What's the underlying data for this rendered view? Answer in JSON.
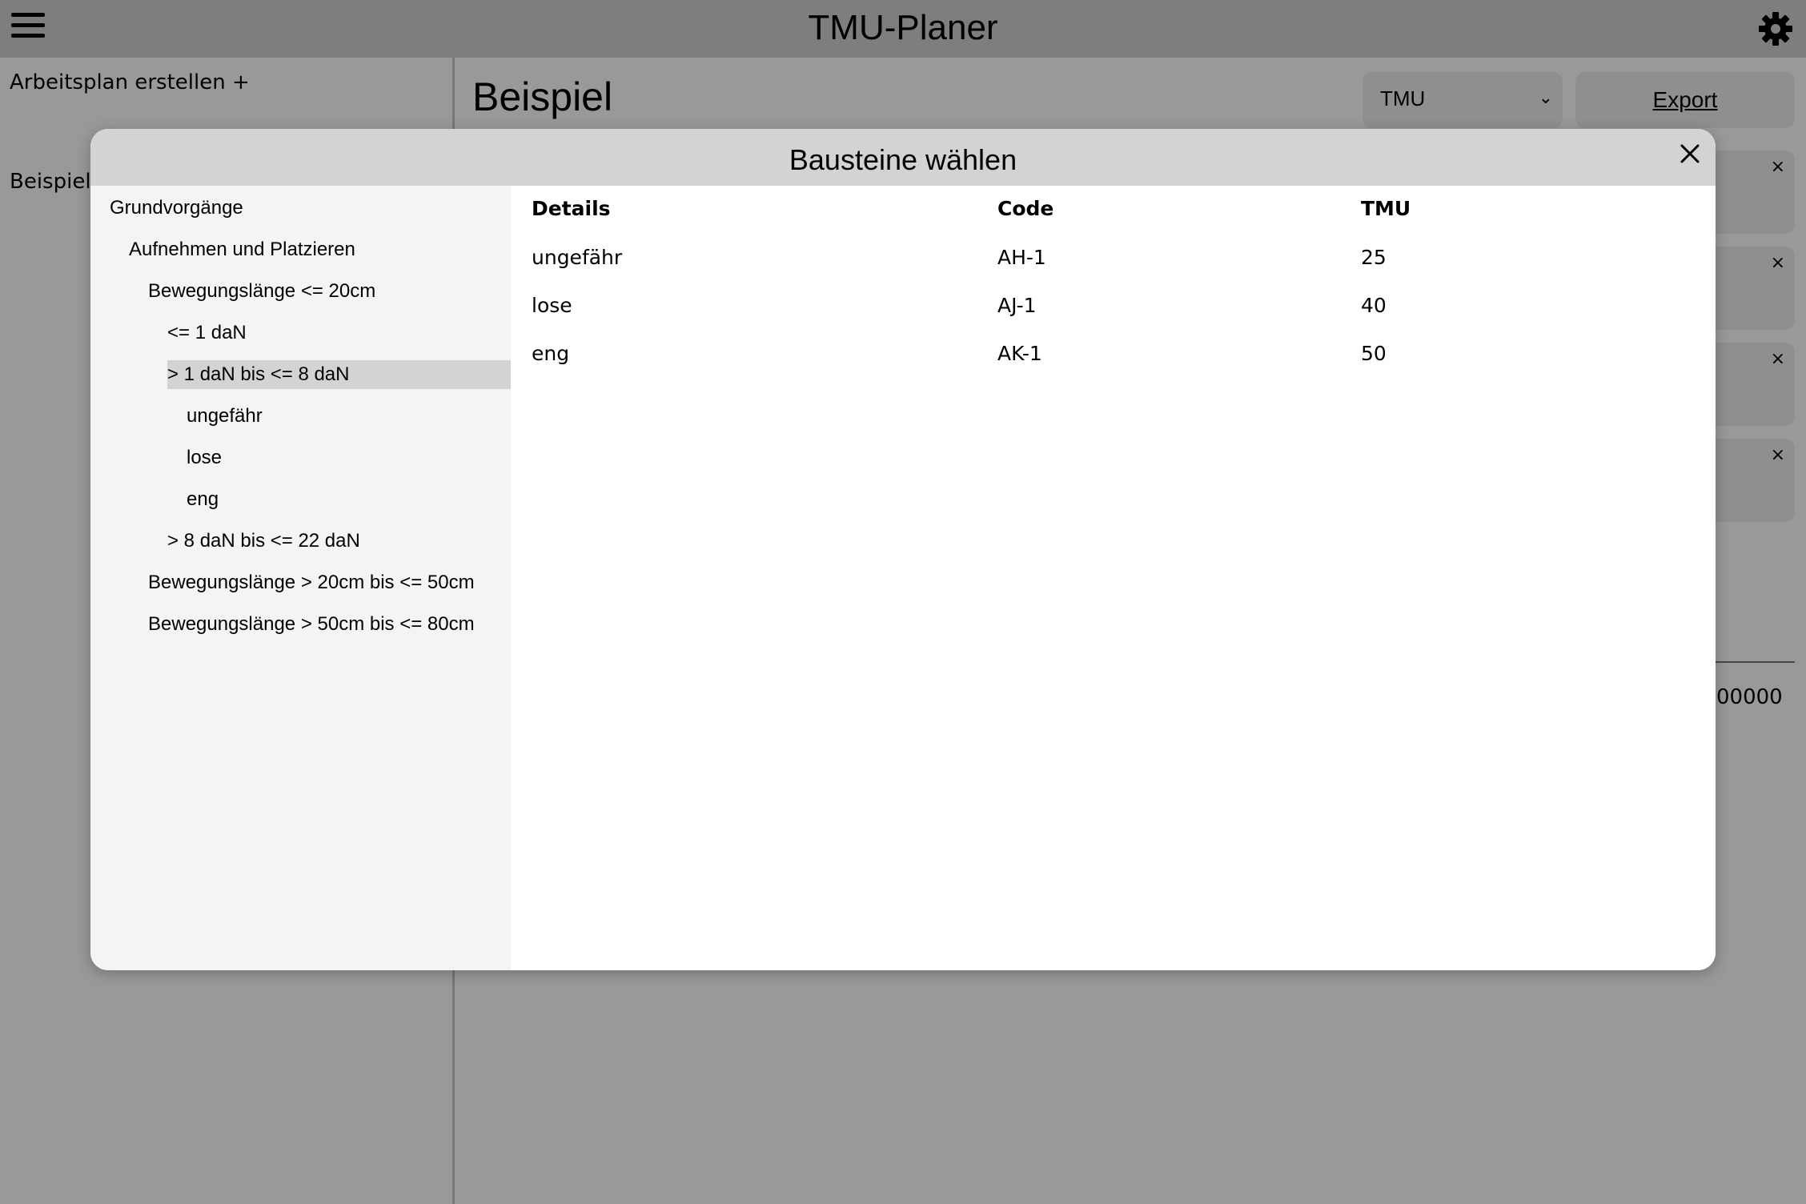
{
  "app": {
    "title": "TMU-Planer"
  },
  "topbar": {
    "menu_icon": "hamburger-menu-icon",
    "settings_icon": "gear-icon"
  },
  "sidebar": {
    "create_label": "Arbeitsplan erstellen +",
    "plans": [
      "Beispiel"
    ]
  },
  "main": {
    "title": "Beispiel",
    "unit_select": {
      "value": "TMU",
      "icon": "chevron-down-icon"
    },
    "export_label": "Export",
    "step_close_glyph": "×",
    "total_value_partial": "00000"
  },
  "modal": {
    "title": "Bausteine wählen",
    "close_icon": "close-icon",
    "tree": [
      {
        "label": "Grundvorgänge",
        "level": 0
      },
      {
        "label": "Aufnehmen und Platzieren",
        "level": 1
      },
      {
        "label": "Bewegungslänge <= 20cm",
        "level": 2
      },
      {
        "label": "<= 1 daN",
        "level": 3
      },
      {
        "label": "> 1 daN bis <= 8 daN",
        "level": 3,
        "selected": true
      },
      {
        "label": "ungefähr",
        "level": 4
      },
      {
        "label": "lose",
        "level": 4
      },
      {
        "label": "eng",
        "level": 4
      },
      {
        "label": "> 8 daN bis <= 22 daN",
        "level": 3
      },
      {
        "label": "Bewegungslänge > 20cm bis <= 50cm",
        "level": 2
      },
      {
        "label": "Bewegungslänge > 50cm bis <= 80cm",
        "level": 2
      }
    ],
    "table": {
      "headers": [
        "Details",
        "Code",
        "TMU"
      ],
      "rows": [
        [
          "ungefähr",
          "AH-1",
          "25"
        ],
        [
          "lose",
          "AJ-1",
          "40"
        ],
        [
          "eng",
          "AK-1",
          "50"
        ]
      ]
    }
  }
}
